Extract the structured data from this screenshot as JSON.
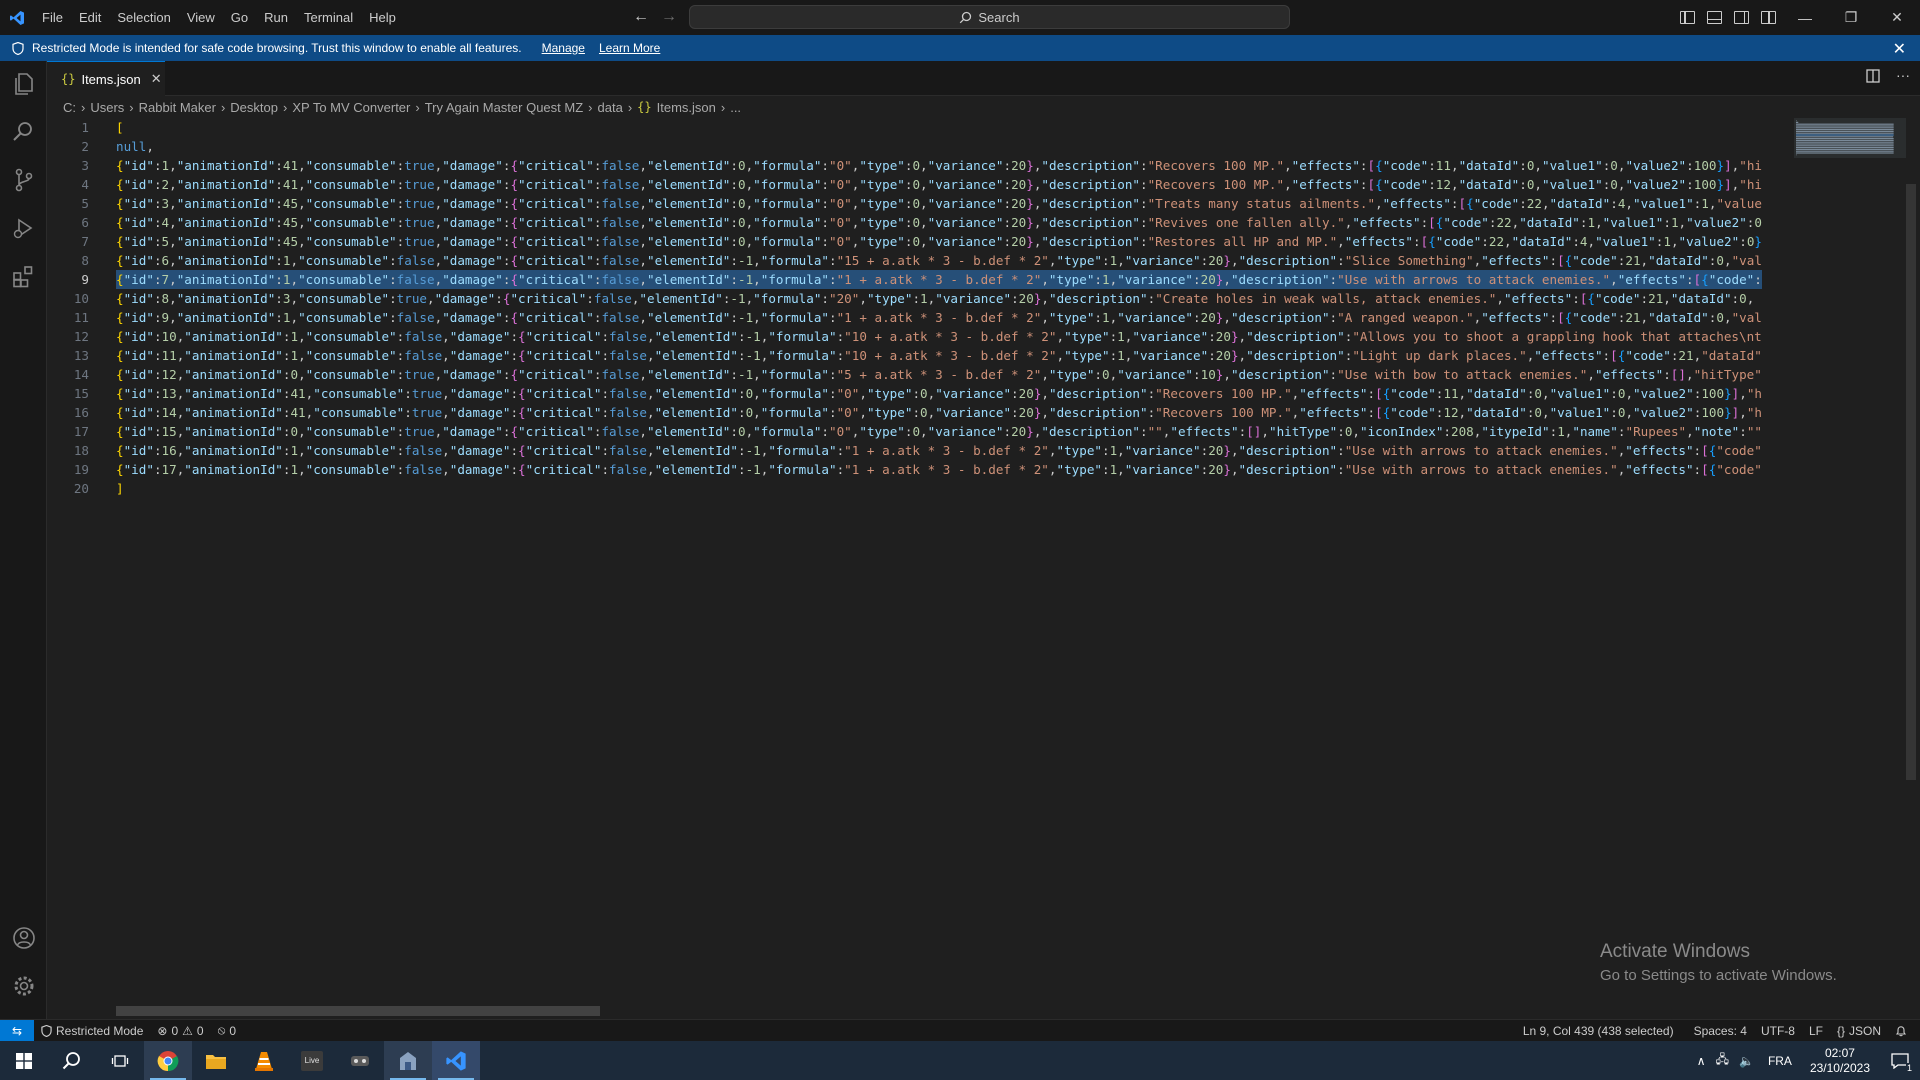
{
  "menu": [
    "File",
    "Edit",
    "Selection",
    "View",
    "Go",
    "Run",
    "Terminal",
    "Help"
  ],
  "search": {
    "label": "Search"
  },
  "banner": {
    "text": "Restricted Mode is intended for safe code browsing. Trust this window to enable all features.",
    "manage": "Manage",
    "learn_more": "Learn More"
  },
  "tab": {
    "icon": "{}",
    "label": "Items.json",
    "close": "✕"
  },
  "breadcrumb": [
    "C:",
    "Users",
    "Rabbit Maker",
    "Desktop",
    "XP To MV Converter",
    "Try Again Master Quest MZ",
    "data"
  ],
  "breadcrumb_file": "Items.json",
  "breadcrumb_tail": "...",
  "lines": [
    {
      "n": "1",
      "t": "["
    },
    {
      "n": "2",
      "t": "null,"
    },
    {
      "n": "3",
      "t": "{\"id\":1,\"animationId\":41,\"consumable\":true,\"damage\":{\"critical\":false,\"elementId\":0,\"formula\":\"0\",\"type\":0,\"variance\":20},\"description\":\"Recovers 100 MP.\",\"effects\":[{\"code\":11,\"dataId\":0,\"value1\":0,\"value2\":100}],\"hi"
    },
    {
      "n": "4",
      "t": "{\"id\":2,\"animationId\":41,\"consumable\":true,\"damage\":{\"critical\":false,\"elementId\":0,\"formula\":\"0\",\"type\":0,\"variance\":20},\"description\":\"Recovers 100 MP.\",\"effects\":[{\"code\":12,\"dataId\":0,\"value1\":0,\"value2\":100}],\"hi"
    },
    {
      "n": "5",
      "t": "{\"id\":3,\"animationId\":45,\"consumable\":true,\"damage\":{\"critical\":false,\"elementId\":0,\"formula\":\"0\",\"type\":0,\"variance\":20},\"description\":\"Treats many status ailments.\",\"effects\":[{\"code\":22,\"dataId\":4,\"value1\":1,\"value"
    },
    {
      "n": "6",
      "t": "{\"id\":4,\"animationId\":45,\"consumable\":true,\"damage\":{\"critical\":false,\"elementId\":0,\"formula\":\"0\",\"type\":0,\"variance\":20},\"description\":\"Revives one fallen ally.\",\"effects\":[{\"code\":22,\"dataId\":1,\"value1\":1,\"value2\":0"
    },
    {
      "n": "7",
      "t": "{\"id\":5,\"animationId\":45,\"consumable\":true,\"damage\":{\"critical\":false,\"elementId\":0,\"formula\":\"0\",\"type\":0,\"variance\":20},\"description\":\"Restores all HP and MP.\",\"effects\":[{\"code\":22,\"dataId\":4,\"value1\":1,\"value2\":0}"
    },
    {
      "n": "8",
      "t": "{\"id\":6,\"animationId\":1,\"consumable\":false,\"damage\":{\"critical\":false,\"elementId\":-1,\"formula\":\"15 + a.atk * 3 - b.def * 2\",\"type\":1,\"variance\":20},\"description\":\"Slice Something\",\"effects\":[{\"code\":21,\"dataId\":0,\"val"
    },
    {
      "n": "9",
      "t": "{\"id\":7,\"animationId\":1,\"consumable\":false,\"damage\":{\"critical\":false,\"elementId\":-1,\"formula\":\"1 + a.atk * 3 - b.def * 2\",\"type\":1,\"variance\":20},\"description\":\"Use with arrows to attack enemies.\",\"effects\":[{\"code\":"
    },
    {
      "n": "10",
      "t": "{\"id\":8,\"animationId\":3,\"consumable\":true,\"damage\":{\"critical\":false,\"elementId\":-1,\"formula\":\"20\",\"type\":1,\"variance\":20},\"description\":\"Create holes in weak walls, attack enemies.\",\"effects\":[{\"code\":21,\"dataId\":0,"
    },
    {
      "n": "11",
      "t": "{\"id\":9,\"animationId\":1,\"consumable\":false,\"damage\":{\"critical\":false,\"elementId\":-1,\"formula\":\"1 + a.atk * 3 - b.def * 2\",\"type\":1,\"variance\":20},\"description\":\"A ranged weapon.\",\"effects\":[{\"code\":21,\"dataId\":0,\"val"
    },
    {
      "n": "12",
      "t": "{\"id\":10,\"animationId\":1,\"consumable\":false,\"damage\":{\"critical\":false,\"elementId\":-1,\"formula\":\"10 + a.atk * 3 - b.def * 2\",\"type\":1,\"variance\":20},\"description\":\"Allows you to shoot a grappling hook that attaches\\nt"
    },
    {
      "n": "13",
      "t": "{\"id\":11,\"animationId\":1,\"consumable\":false,\"damage\":{\"critical\":false,\"elementId\":-1,\"formula\":\"10 + a.atk * 3 - b.def * 2\",\"type\":1,\"variance\":20},\"description\":\"Light up dark places.\",\"effects\":[{\"code\":21,\"dataId\""
    },
    {
      "n": "14",
      "t": "{\"id\":12,\"animationId\":0,\"consumable\":true,\"damage\":{\"critical\":false,\"elementId\":-1,\"formula\":\"5 + a.atk * 3 - b.def * 2\",\"type\":0,\"variance\":10},\"description\":\"Use with bow to attack enemies.\",\"effects\":[],\"hitType\""
    },
    {
      "n": "15",
      "t": "{\"id\":13,\"animationId\":41,\"consumable\":true,\"damage\":{\"critical\":false,\"elementId\":0,\"formula\":\"0\",\"type\":0,\"variance\":20},\"description\":\"Recovers 100 HP.\",\"effects\":[{\"code\":11,\"dataId\":0,\"value1\":0,\"value2\":100}],\"h"
    },
    {
      "n": "16",
      "t": "{\"id\":14,\"animationId\":41,\"consumable\":true,\"damage\":{\"critical\":false,\"elementId\":0,\"formula\":\"0\",\"type\":0,\"variance\":20},\"description\":\"Recovers 100 MP.\",\"effects\":[{\"code\":12,\"dataId\":0,\"value1\":0,\"value2\":100}],\"h"
    },
    {
      "n": "17",
      "t": "{\"id\":15,\"animationId\":0,\"consumable\":true,\"damage\":{\"critical\":false,\"elementId\":0,\"formula\":\"0\",\"type\":0,\"variance\":20},\"description\":\"\",\"effects\":[],\"hitType\":0,\"iconIndex\":208,\"itypeId\":1,\"name\":\"Rupees\",\"note\":\"\""
    },
    {
      "n": "18",
      "t": "{\"id\":16,\"animationId\":1,\"consumable\":false,\"damage\":{\"critical\":false,\"elementId\":-1,\"formula\":\"1 + a.atk * 3 - b.def * 2\",\"type\":1,\"variance\":20},\"description\":\"Use with arrows to attack enemies.\",\"effects\":[{\"code\""
    },
    {
      "n": "19",
      "t": "{\"id\":17,\"animationId\":1,\"consumable\":false,\"damage\":{\"critical\":false,\"elementId\":-1,\"formula\":\"1 + a.atk * 3 - b.def * 2\",\"type\":1,\"variance\":20},\"description\":\"Use with arrows to attack enemies.\",\"effects\":[{\"code\""
    },
    {
      "n": "20",
      "t": "]"
    }
  ],
  "active_line": "9",
  "watermark": {
    "title": "Activate Windows",
    "subtitle": "Go to Settings to activate Windows."
  },
  "status": {
    "restricted": "Restricted Mode",
    "errors": "0",
    "warnings": "0",
    "ports": "0",
    "position": "Ln 9, Col 439 (438 selected)",
    "spaces": "Spaces: 4",
    "encoding": "UTF-8",
    "eol": "LF",
    "language": "JSON"
  },
  "tray": {
    "lang": "FRA",
    "time": "02:07",
    "date": "23/10/2023",
    "notifications": "1"
  },
  "colors": {
    "accent": "#0078d4",
    "banner": "#0e4b86",
    "selection": "#264f78"
  }
}
